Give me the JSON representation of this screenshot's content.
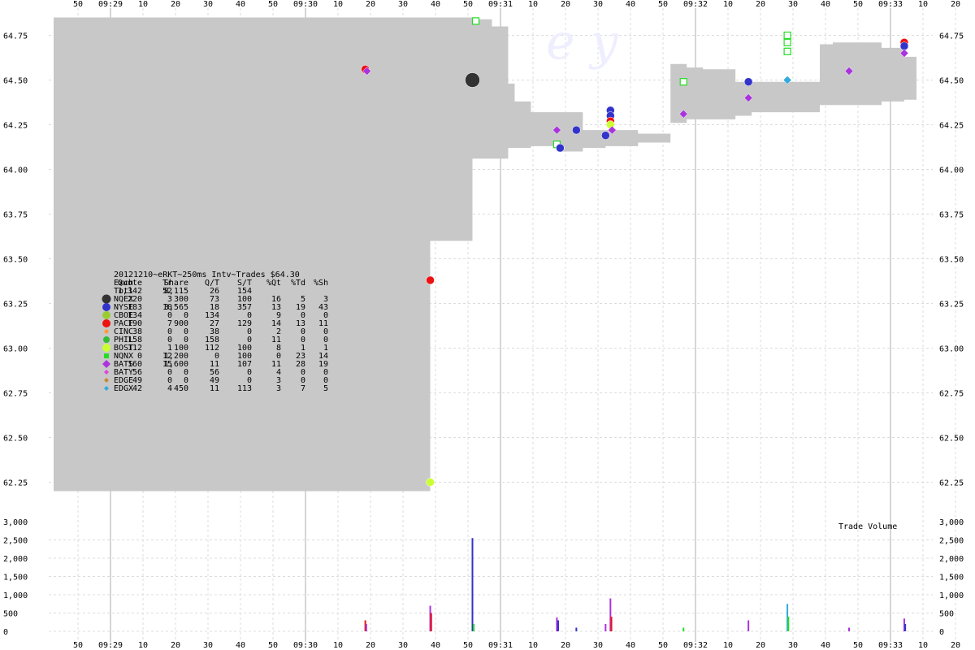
{
  "chart_data": [
    {
      "type": "area",
      "subtype": "quote-spread-with-trade-markers",
      "title": "20121210~eRKT~250ms Intv~Trades $64.30",
      "x_ticks_top": [
        "50",
        "09:29",
        "10",
        "20",
        "30",
        "40",
        "50",
        "09:30",
        "10",
        "20",
        "30",
        "40",
        "50",
        "09:31",
        "10",
        "20",
        "30",
        "40",
        "50",
        "09:32",
        "10",
        "20",
        "30",
        "40",
        "50",
        "09:33",
        "10",
        "20"
      ],
      "x_ticks_bottom": [
        "50",
        "09:29",
        "10",
        "20",
        "30",
        "40",
        "50",
        "09:30",
        "10",
        "20",
        "30",
        "40",
        "50",
        "09:31",
        "10",
        "20",
        "30",
        "40",
        "50",
        "09:32",
        "10",
        "20",
        "30",
        "40",
        "50",
        "09:33",
        "10",
        "20"
      ],
      "y_ticks": [
        "64.75",
        "64.50",
        "64.25",
        "64.00",
        "63.75",
        "63.50",
        "63.25",
        "63.00",
        "62.75",
        "62.50",
        "62.25"
      ],
      "ylim": [
        62.18,
        64.85
      ],
      "xlim_seconds": [
        0,
        272
      ],
      "grid": true,
      "spread_band_color": "#c8c8c8",
      "spread_band": {
        "t": [
          0,
          116,
          116,
          129,
          129,
          135,
          140,
          142,
          147,
          155,
          163,
          170,
          180,
          185,
          190,
          195,
          200,
          210,
          215,
          230,
          236,
          240,
          255,
          262,
          275,
          275
        ],
        "bid": [
          62.2,
          62.2,
          63.6,
          63.62,
          64.06,
          64.06,
          64.12,
          64.12,
          64.13,
          64.1,
          64.12,
          64.13,
          64.15,
          64.15,
          64.26,
          64.28,
          64.28,
          64.3,
          64.32,
          64.32,
          64.36,
          64.36,
          64.38,
          64.39,
          64.39,
          64.39
        ],
        "ask": [
          64.85,
          64.85,
          64.85,
          64.85,
          64.84,
          64.8,
          64.48,
          64.38,
          64.32,
          64.32,
          64.22,
          64.22,
          64.2,
          64.2,
          64.59,
          64.57,
          64.56,
          64.49,
          64.49,
          64.49,
          64.7,
          64.71,
          64.68,
          64.63,
          64.73,
          64.73
        ]
      },
      "markers": [
        {
          "t": 96,
          "price": 64.56,
          "exchange": "PACF"
        },
        {
          "t": 96.5,
          "price": 64.55,
          "exchange": "BATS"
        },
        {
          "t": 116,
          "price": 63.38,
          "exchange": "PACF"
        },
        {
          "t": 116,
          "price": 62.25,
          "exchange": "BOST"
        },
        {
          "t": 129,
          "price": 64.5,
          "exchange": "NQEX"
        },
        {
          "t": 130,
          "price": 64.83,
          "exchange": "NQNX"
        },
        {
          "t": 155,
          "price": 64.22,
          "exchange": "BATS"
        },
        {
          "t": 155,
          "price": 64.14,
          "exchange": "NQNX"
        },
        {
          "t": 156,
          "price": 64.12,
          "exchange": "NYSE"
        },
        {
          "t": 161,
          "price": 64.22,
          "exchange": "NYSE"
        },
        {
          "t": 170,
          "price": 64.19,
          "exchange": "NYSE"
        },
        {
          "t": 171.5,
          "price": 64.33,
          "exchange": "NYSE"
        },
        {
          "t": 171.5,
          "price": 64.3,
          "exchange": "NYSE"
        },
        {
          "t": 171.5,
          "price": 64.27,
          "exchange": "PACF"
        },
        {
          "t": 171.5,
          "price": 64.25,
          "exchange": "BOST"
        },
        {
          "t": 172,
          "price": 64.22,
          "exchange": "BATS"
        },
        {
          "t": 194,
          "price": 64.31,
          "exchange": "BATS"
        },
        {
          "t": 194,
          "price": 64.49,
          "exchange": "NQNX"
        },
        {
          "t": 214,
          "price": 64.49,
          "exchange": "NYSE"
        },
        {
          "t": 214,
          "price": 64.4,
          "exchange": "BATS"
        },
        {
          "t": 226,
          "price": 64.75,
          "exchange": "NQNX"
        },
        {
          "t": 226,
          "price": 64.71,
          "exchange": "NQNX"
        },
        {
          "t": 226,
          "price": 64.66,
          "exchange": "NQNX"
        },
        {
          "t": 226,
          "price": 64.5,
          "exchange": "EDGX"
        },
        {
          "t": 245,
          "price": 64.55,
          "exchange": "BATS"
        },
        {
          "t": 262,
          "price": 64.71,
          "exchange": "PACF"
        },
        {
          "t": 262,
          "price": 64.69,
          "exchange": "NYSE"
        },
        {
          "t": 262,
          "price": 64.65,
          "exchange": "BATS"
        }
      ],
      "watermark": "e    y"
    },
    {
      "type": "bar",
      "title": "Trade Volume",
      "y_ticks": [
        "3,000",
        "2,500",
        "2,000",
        "1,500",
        "1,000",
        "500",
        "0"
      ],
      "ylim": [
        0,
        3000
      ],
      "bars": [
        {
          "t": 96,
          "value": 300,
          "exchange": "PACF"
        },
        {
          "t": 96.3,
          "value": 200,
          "exchange": "BATS"
        },
        {
          "t": 116,
          "value": 700,
          "exchange": "BATS"
        },
        {
          "t": 116.3,
          "value": 500,
          "exchange": "PACF"
        },
        {
          "t": 129,
          "value": 2550,
          "exchange": "NYSE"
        },
        {
          "t": 129.4,
          "value": 200,
          "exchange": "NQNX"
        },
        {
          "t": 155,
          "value": 380,
          "exchange": "BATS"
        },
        {
          "t": 155.4,
          "value": 300,
          "exchange": "NYSE"
        },
        {
          "t": 161,
          "value": 100,
          "exchange": "NYSE"
        },
        {
          "t": 170,
          "value": 200,
          "exchange": "BATS"
        },
        {
          "t": 171.5,
          "value": 900,
          "exchange": "BATS"
        },
        {
          "t": 171.8,
          "value": 400,
          "exchange": "PACF"
        },
        {
          "t": 194,
          "value": 100,
          "exchange": "NQNX"
        },
        {
          "t": 214,
          "value": 300,
          "exchange": "BATS"
        },
        {
          "t": 226,
          "value": 750,
          "exchange": "EDGX"
        },
        {
          "t": 226.3,
          "value": 400,
          "exchange": "NQNX"
        },
        {
          "t": 245,
          "value": 100,
          "exchange": "BATS"
        },
        {
          "t": 262,
          "value": 350,
          "exchange": "BATS"
        },
        {
          "t": 262.3,
          "value": 200,
          "exchange": "NYSE"
        }
      ]
    }
  ],
  "stats_table": {
    "title": "20121210~eRKT~250ms Intv~Trades $64.30",
    "header": [
      "Exch",
      "Quote",
      "Tr",
      "Share",
      "Q/T",
      "S/T",
      "%Qt",
      "%Td",
      "%Sh"
    ],
    "total": [
      "Totl",
      "1,342",
      "52",
      "8,115",
      "26",
      "154",
      "",
      "",
      ""
    ],
    "rows": [
      {
        "exch": "NQEX",
        "quote": "220",
        "tr": "3",
        "share": "300",
        "qt": "73",
        "st": "100",
        "pqt": "16",
        "ptd": "5",
        "psh": "3",
        "color": "#333333",
        "shape": "circle-big"
      },
      {
        "exch": "NYSE",
        "quote": "183",
        "tr": "10",
        "share": "3,565",
        "qt": "18",
        "st": "357",
        "pqt": "13",
        "ptd": "19",
        "psh": "43",
        "color": "#3333cc",
        "shape": "circle"
      },
      {
        "exch": "CBOE",
        "quote": "134",
        "tr": "0",
        "share": "0",
        "qt": "134",
        "st": "0",
        "pqt": "9",
        "ptd": "0",
        "psh": "0",
        "color": "#99cc33",
        "shape": "circle"
      },
      {
        "exch": "PACF",
        "quote": "190",
        "tr": "7",
        "share": "900",
        "qt": "27",
        "st": "129",
        "pqt": "14",
        "ptd": "13",
        "psh": "11",
        "color": "#ee1111",
        "shape": "circle"
      },
      {
        "exch": "CINC",
        "quote": "38",
        "tr": "0",
        "share": "0",
        "qt": "38",
        "st": "0",
        "pqt": "2",
        "ptd": "0",
        "psh": "0",
        "color": "#ff9933",
        "shape": "dot"
      },
      {
        "exch": "PHIL",
        "quote": "158",
        "tr": "0",
        "share": "0",
        "qt": "158",
        "st": "0",
        "pqt": "11",
        "ptd": "0",
        "psh": "0",
        "color": "#33bb33",
        "shape": "circle-small"
      },
      {
        "exch": "BOST",
        "quote": "112",
        "tr": "1",
        "share": "100",
        "qt": "112",
        "st": "100",
        "pqt": "8",
        "ptd": "1",
        "psh": "1",
        "color": "#ccff33",
        "shape": "circle"
      },
      {
        "exch": "NQNX",
        "quote": "0",
        "tr": "12",
        "share": "1,200",
        "qt": "0",
        "st": "100",
        "pqt": "0",
        "ptd": "23",
        "psh": "14",
        "color": "#22dd22",
        "shape": "square"
      },
      {
        "exch": "BATS",
        "quote": "160",
        "tr": "15",
        "share": "1,600",
        "qt": "11",
        "st": "107",
        "pqt": "11",
        "ptd": "28",
        "psh": "19",
        "color": "#aa33dd",
        "shape": "diamond"
      },
      {
        "exch": "BATY",
        "quote": "56",
        "tr": "0",
        "share": "0",
        "qt": "56",
        "st": "0",
        "pqt": "4",
        "ptd": "0",
        "psh": "0",
        "color": "#dd44dd",
        "shape": "diamond-small"
      },
      {
        "exch": "EDGE",
        "quote": "49",
        "tr": "0",
        "share": "0",
        "qt": "49",
        "st": "0",
        "pqt": "3",
        "ptd": "0",
        "psh": "0",
        "color": "#cc8833",
        "shape": "diamond-small"
      },
      {
        "exch": "EDGX",
        "quote": "42",
        "tr": "4",
        "share": "450",
        "qt": "11",
        "st": "113",
        "pqt": "3",
        "ptd": "7",
        "psh": "5",
        "color": "#33aadd",
        "shape": "diamond-small"
      }
    ]
  },
  "exchange_colors": {
    "NQEX": "#333333",
    "NYSE": "#3333cc",
    "CBOE": "#99cc33",
    "PACF": "#ee1111",
    "CINC": "#ff9933",
    "PHIL": "#33bb33",
    "BOST": "#ccff33",
    "NQNX": "#22dd22",
    "BATS": "#aa33dd",
    "BATY": "#dd44dd",
    "EDGE": "#cc8833",
    "EDGX": "#33aadd"
  }
}
